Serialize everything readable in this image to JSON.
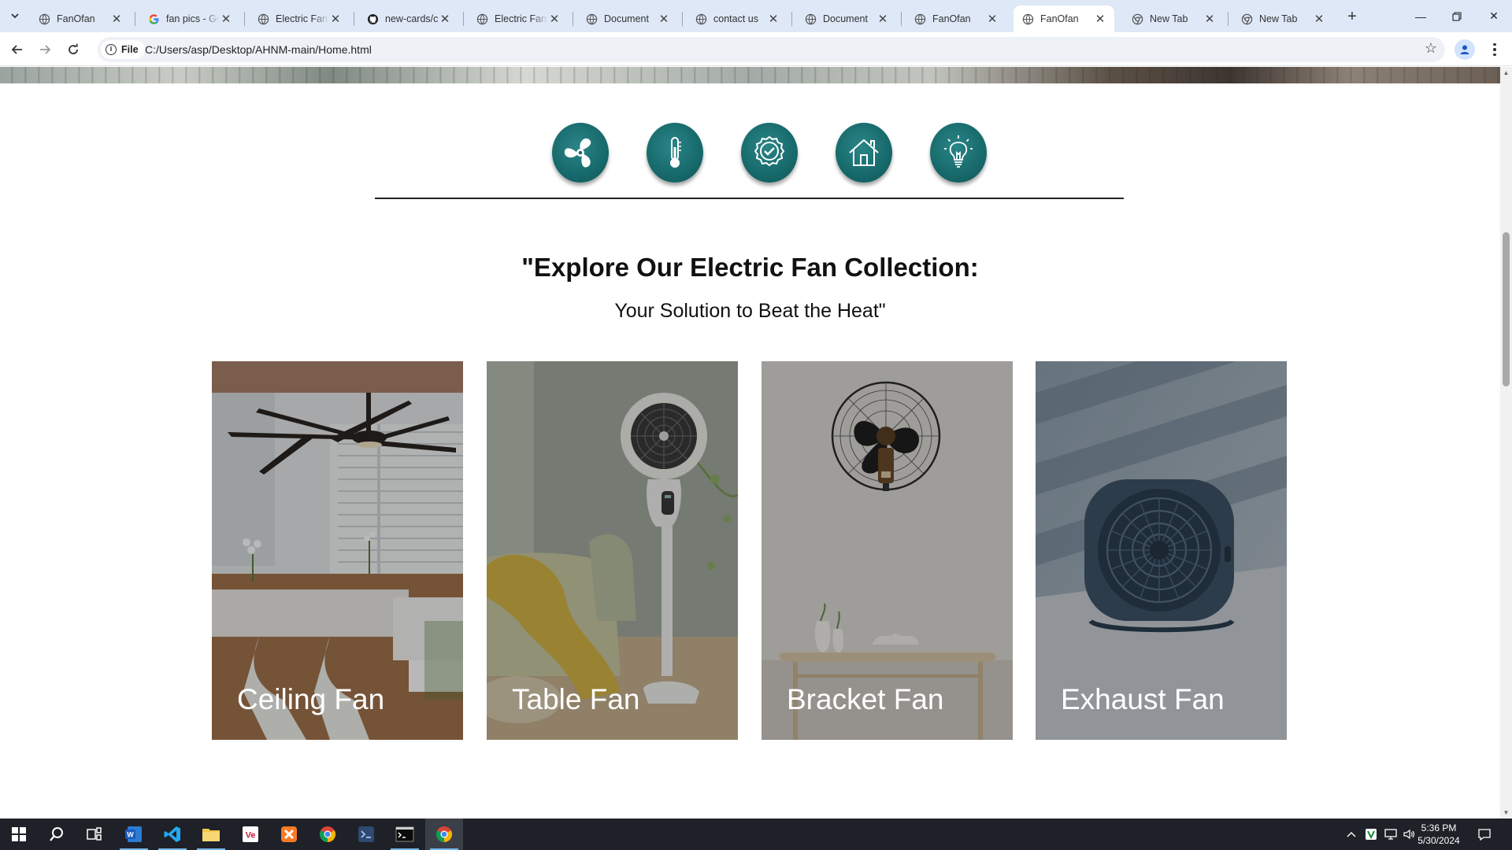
{
  "browser": {
    "tabs": [
      {
        "title": "FanOfan",
        "favicon": "globe-icon",
        "active": false
      },
      {
        "title": "fan pics - Go",
        "favicon": "google-icon",
        "active": false
      },
      {
        "title": "Electric Fan C",
        "favicon": "globe-icon",
        "active": false
      },
      {
        "title": "new-cards/c",
        "favicon": "github-icon",
        "active": false
      },
      {
        "title": "Electric Fan C",
        "favicon": "globe-icon",
        "active": false
      },
      {
        "title": "Document",
        "favicon": "globe-icon",
        "active": false
      },
      {
        "title": "contact us",
        "favicon": "globe-icon",
        "active": false
      },
      {
        "title": "Document",
        "favicon": "globe-icon",
        "active": false
      },
      {
        "title": "FanOfan",
        "favicon": "globe-icon",
        "active": false
      },
      {
        "title": "FanOfan",
        "favicon": "globe-icon",
        "active": true
      },
      {
        "title": "New Tab",
        "favicon": "chrome-icon",
        "active": false
      },
      {
        "title": "New Tab",
        "favicon": "chrome-icon",
        "active": false
      }
    ],
    "address_chip": "File",
    "url": "C:/Users/asp/Desktop/AHNM-main/Home.html"
  },
  "page": {
    "features": [
      {
        "icon": "fan-icon"
      },
      {
        "icon": "thermometer-icon"
      },
      {
        "icon": "quality-badge-icon"
      },
      {
        "icon": "home-icon"
      },
      {
        "icon": "lightbulb-icon"
      }
    ],
    "heading": "\"Explore Our Electric Fan Collection:",
    "subheading": "Your Solution to Beat the Heat\"",
    "cards": [
      {
        "label": "Ceiling Fan"
      },
      {
        "label": "Table Fan"
      },
      {
        "label": "Bracket Fan"
      },
      {
        "label": "Exhaust Fan"
      }
    ],
    "accent_color": "#17696b"
  },
  "taskbar": {
    "apps": [
      "windows-start-icon",
      "search-icon",
      "task-view-icon",
      "word-icon",
      "vscode-icon",
      "file-explorer-icon",
      "vs-project-icon",
      "xampp-icon",
      "chrome-icon",
      "visual-studio-icon",
      "terminal-icon",
      "chrome-active-icon"
    ],
    "clock": {
      "time": "5:36 PM",
      "date": "5/30/2024"
    }
  }
}
